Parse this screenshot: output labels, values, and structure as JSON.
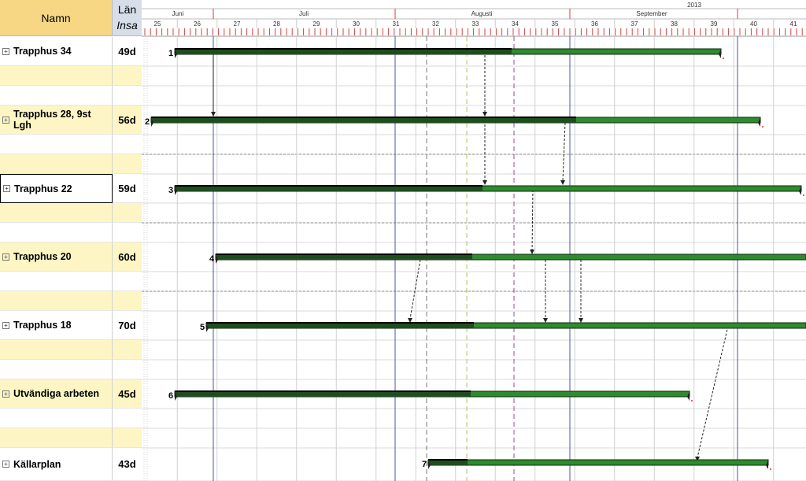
{
  "header": {
    "name_label": "Namn",
    "len_label_1": "Län",
    "len_label_2": "Insa"
  },
  "timeline": {
    "year": "2013",
    "months": [
      "Juni",
      "Juli",
      "Augusti",
      "September"
    ],
    "weeks": [
      "25",
      "26",
      "27",
      "28",
      "29",
      "30",
      "31",
      "32",
      "33",
      "34",
      "35",
      "36",
      "37",
      "38",
      "39",
      "40",
      "41"
    ]
  },
  "tasks": [
    {
      "num": "1",
      "name": "Trapphus 34",
      "duration": "49d"
    },
    {
      "num": "2",
      "name": "Trapphus 28, 9st Lgh",
      "duration": "56d"
    },
    {
      "num": "3",
      "name": "Trapphus 22",
      "duration": "59d"
    },
    {
      "num": "4",
      "name": "Trapphus 20",
      "duration": "60d"
    },
    {
      "num": "5",
      "name": "Trapphus 18",
      "duration": "70d"
    },
    {
      "num": "6",
      "name": "Utvändiga arbeten",
      "duration": "45d"
    },
    {
      "num": "7",
      "name": "Källarplan",
      "duration": "43d"
    }
  ],
  "colors": {
    "bar_done": "#1e4d1e",
    "bar_todo": "#2e8b2e",
    "bar_border": "#0d2a0d",
    "alt_row": "#fdf6c4",
    "header_name": "#f7d784",
    "header_len": "#d6dfe9",
    "week_line": "#4a55a2",
    "red_tick": "#d64040"
  }
}
